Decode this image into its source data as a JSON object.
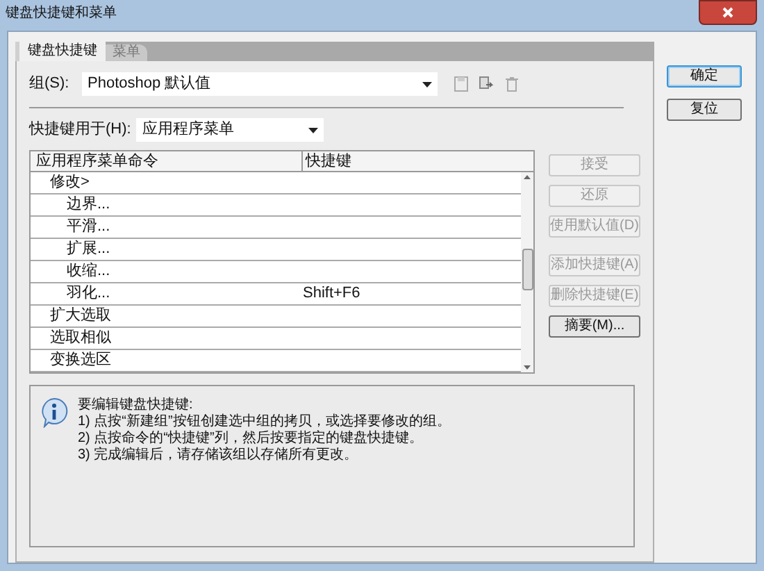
{
  "window": {
    "title": "键盘快捷键和菜单"
  },
  "tabs": [
    {
      "label": "键盘快捷键",
      "selected": true
    },
    {
      "label": "菜单",
      "selected": false
    }
  ],
  "group": {
    "label": "组(S):",
    "value": "Photoshop 默认值"
  },
  "shortcuts_for": {
    "label": "快捷键用于(H):",
    "value": "应用程序菜单"
  },
  "table": {
    "columns": [
      "应用程序菜单命令",
      "快捷键"
    ],
    "rows": [
      {
        "command": "修改>",
        "children": [
          {
            "command": "边界..."
          },
          {
            "command": "平滑..."
          },
          {
            "command": "扩展..."
          },
          {
            "command": "收缩..."
          },
          {
            "command": "羽化...",
            "shortcut": "Shift+F6"
          }
        ]
      },
      {
        "command": "扩大选取"
      },
      {
        "command": "选取相似"
      },
      {
        "command": "变换选区"
      }
    ]
  },
  "side_buttons": [
    {
      "label": "接受",
      "disabled": true
    },
    {
      "label": "还原",
      "disabled": true
    },
    {
      "label": "使用默认值(D)",
      "disabled": true
    },
    {
      "label": "添加快捷键(A)",
      "disabled": true
    },
    {
      "label": "删除快捷键(E)",
      "disabled": true
    },
    {
      "label": "摘要(M)...",
      "disabled": false
    }
  ],
  "dialog_buttons": [
    {
      "label": "确定",
      "primary": true
    },
    {
      "label": "复位",
      "primary": false
    }
  ],
  "info": {
    "title": "要编辑键盘快捷键:",
    "lines": [
      "1) 点按“新建组”按钮创建选中组的拷贝，或选择要修改的组。",
      "2) 点按命令的“快捷键”列，然后按要指定的键盘快捷键。",
      "3) 完成编辑后，请存储该组以存储所有更改。"
    ]
  }
}
